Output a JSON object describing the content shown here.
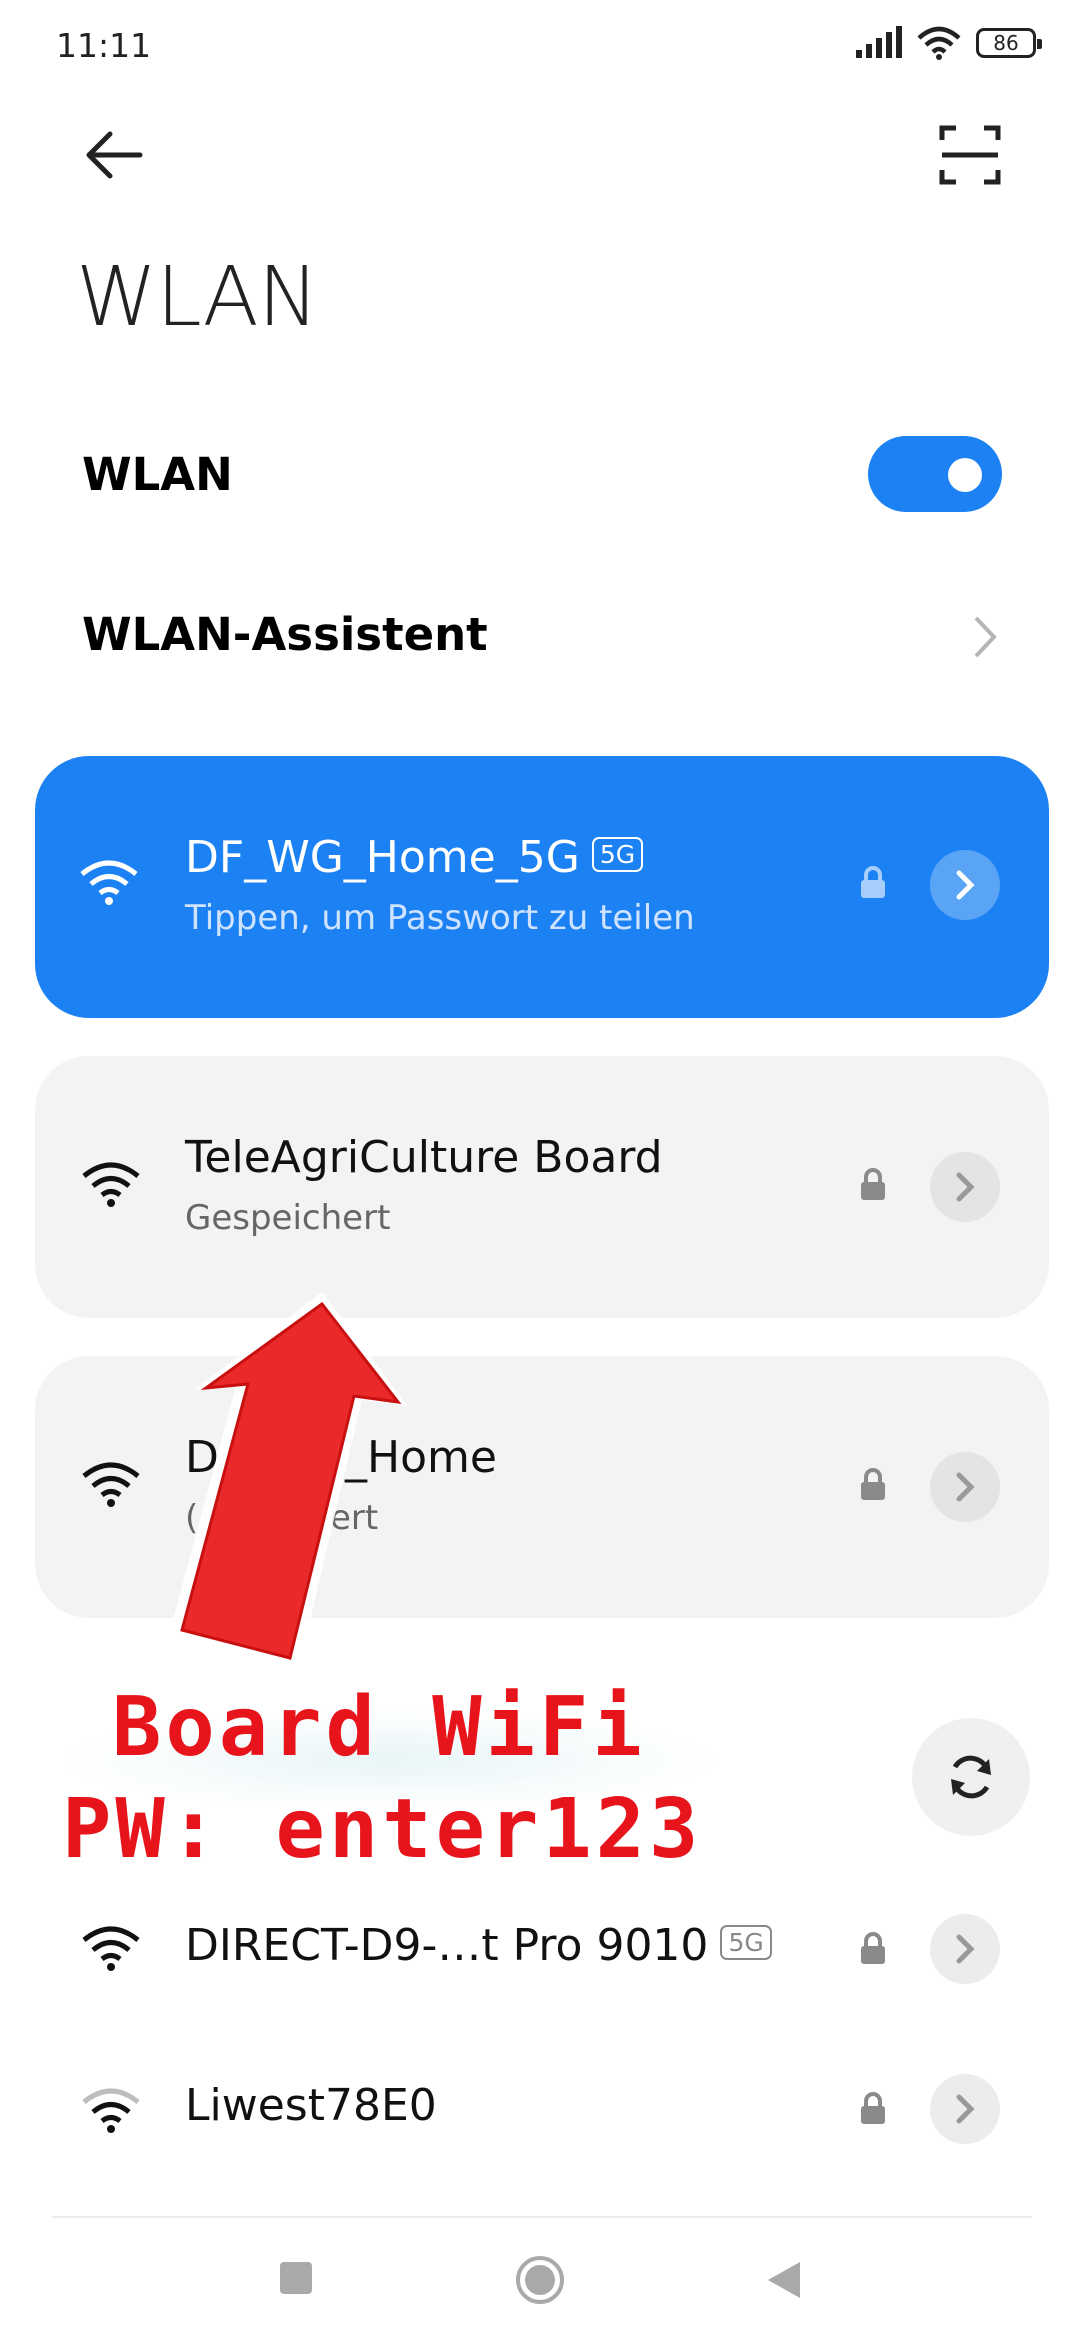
{
  "status_bar": {
    "time": "11:11",
    "battery": "86"
  },
  "header": {
    "title": "WLAN",
    "back_icon": "arrow-left-icon",
    "scan_icon": "qr-scan-icon"
  },
  "settings": {
    "wlan_label": "WLAN",
    "wlan_enabled": true,
    "assistant_label": "WLAN-Assistent"
  },
  "networks": [
    {
      "name": "DF_WG_Home_5G",
      "badge": "5G",
      "subtitle": "Tippen, um Passwort zu teilen",
      "connected": true,
      "secured": true
    },
    {
      "name": "TeleAgriCulture Board",
      "subtitle": "Gespeichert",
      "secured": true
    },
    {
      "name": "D",
      "name_tail": "_Home",
      "subtitle": "(",
      "subtitle_tail": "ert",
      "secured": true
    },
    {
      "name": "DIRECT-D9-…t Pro 9010",
      "badge": "5G",
      "secured": true
    },
    {
      "name": "Liwest78E0",
      "secured": true
    }
  ],
  "annotation": {
    "line1": "Board WiFi",
    "line2": "PW: enter123",
    "color": "#e8141b"
  },
  "colors": {
    "accent": "#1c82f4",
    "card_bg": "#f3f3f3"
  }
}
